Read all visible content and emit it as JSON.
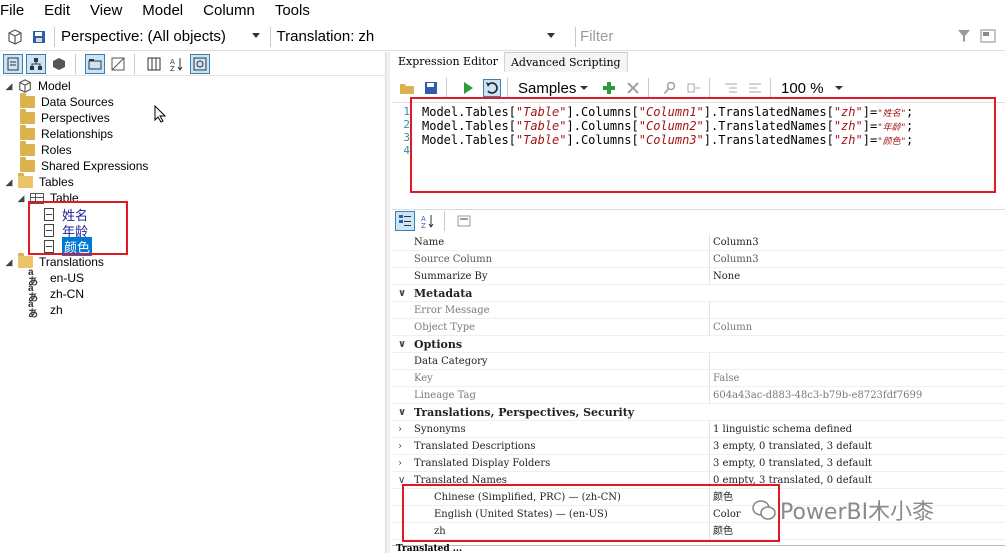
{
  "menu": [
    "File",
    "Edit",
    "View",
    "Model",
    "Column",
    "Tools"
  ],
  "toolbar": {
    "perspective_label": "Perspective:",
    "perspective_value": "(All objects)",
    "translation_label": "Translation:",
    "translation_value": "zh",
    "filter_placeholder": "Filter"
  },
  "tree": {
    "root": "Model",
    "items": [
      "Data Sources",
      "Perspectives",
      "Relationships",
      "Roles",
      "Shared Expressions"
    ],
    "tables_label": "Tables",
    "table_name": "Table",
    "columns": [
      "姓名",
      "年龄",
      "颜色"
    ],
    "translations_label": "Translations",
    "languages": [
      "en-US",
      "zh-CN",
      "zh"
    ]
  },
  "tabs": [
    "Expression Editor",
    "Advanced Scripting"
  ],
  "editor_toolbar": {
    "samples": "Samples",
    "zoom": "100 %"
  },
  "script": {
    "line_numbers": [
      "1",
      "2",
      "3",
      "4"
    ],
    "lines": [
      {
        "pre": "Model.Tables[",
        "t": "\"Table\"",
        "mid": "].Columns[",
        "c": "\"Column1\"",
        "post": "].TranslatedNames[",
        "l": "\"zh\"",
        "eq": "]=",
        "v": "\"姓名\"",
        "end": ";"
      },
      {
        "pre": "Model.Tables[",
        "t": "\"Table\"",
        "mid": "].Columns[",
        "c": "\"Column2\"",
        "post": "].TranslatedNames[",
        "l": "\"zh\"",
        "eq": "]=",
        "v": "\"年龄\"",
        "end": ";"
      },
      {
        "pre": "Model.Tables[",
        "t": "\"Table\"",
        "mid": "].Columns[",
        "c": "\"Column3\"",
        "post": "].TranslatedNames[",
        "l": "\"zh\"",
        "eq": "]=",
        "v": "\"颜色\"",
        "end": ";"
      }
    ]
  },
  "properties": {
    "name_label": "Name",
    "name_value": "Column3",
    "source_label": "Source Column",
    "source_value": "Column3",
    "summarize_label": "Summarize By",
    "summarize_value": "None",
    "cat_metadata": "Metadata",
    "error_label": "Error Message",
    "error_value": "",
    "objtype_label": "Object Type",
    "objtype_value": "Column",
    "cat_options": "Options",
    "datacat_label": "Data Category",
    "datacat_value": "",
    "key_label": "Key",
    "key_value": "False",
    "lineage_label": "Lineage Tag",
    "lineage_value": "604a43ac-d883-48c3-b79b-e8723fdf7699",
    "cat_tps": "Translations, Perspectives, Security",
    "synonyms_label": "Synonyms",
    "synonyms_value": "1 linguistic schema defined",
    "tdesc_label": "Translated Descriptions",
    "tdesc_value": "3 empty, 0 translated, 3 default",
    "tfold_label": "Translated Display Folders",
    "tfold_value": "3 empty, 0 translated, 3 default",
    "tname_label": "Translated Names",
    "tname_value": "0 empty, 3 translated, 0 default",
    "zhcn_label": "Chinese (Simplified, PRC) — (zh-CN)",
    "zhcn_value": "颜色",
    "enus_label": "English (United States) — (en-US)",
    "enus_value": "Color",
    "zh_label": "zh",
    "zh_value": "颜色"
  },
  "watermark": "PowerBI木小桼",
  "bottom_text": "Translated ...",
  "colors": {
    "accent": "#0078d7",
    "highlight_box": "#e0182a",
    "string": "#a31515",
    "line_number": "#2b91af"
  }
}
